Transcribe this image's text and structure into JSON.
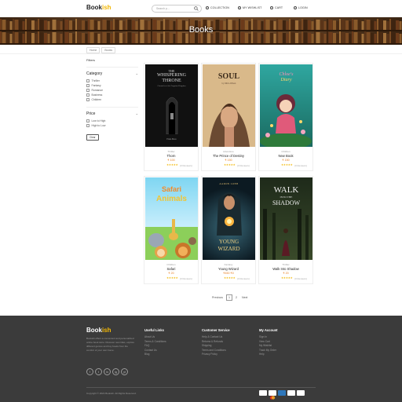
{
  "header": {
    "logo_main": "Book",
    "logo_accent": "ish",
    "search_placeholder": "Search p...",
    "nav": [
      {
        "label": "COLLECTION",
        "icon": "collection-icon"
      },
      {
        "label": "MY WISHLIST",
        "icon": "heart-icon"
      },
      {
        "label": "CART",
        "icon": "cart-icon"
      },
      {
        "label": "LOGIN",
        "icon": "user-icon"
      }
    ]
  },
  "banner": {
    "title": "Books"
  },
  "breadcrumb": [
    "Home",
    "Books"
  ],
  "sidebar": {
    "heading": "Filters",
    "category": {
      "title": "Category",
      "options": [
        "Thriller",
        "Fantasy",
        "Romance",
        "Business",
        "Children"
      ]
    },
    "price": {
      "title": "Price",
      "options": [
        "Low to High",
        "High to Low"
      ],
      "clear_label": "Clear"
    }
  },
  "products": [
    {
      "title": "Thorn",
      "category": "Thriller",
      "price": "₹ 100",
      "stars": "★★★★★",
      "reviews": "(0 Reviews)",
      "cover": "whispering"
    },
    {
      "title": "The Prince of Destiny",
      "category": "Adventure",
      "price": "₹ 150",
      "stars": "★★★★★",
      "reviews": "(0 Reviews)",
      "cover": "soul"
    },
    {
      "title": "New Book",
      "category": "Children",
      "price": "₹ 150",
      "stars": "★★★★★",
      "reviews": "(0 Reviews)",
      "cover": "chloe"
    },
    {
      "title": "Safari",
      "category": "Children",
      "price": "₹ 20",
      "stars": "★★★★★",
      "reviews": "(0 Reviews)",
      "cover": "safari"
    },
    {
      "title": "Young Wizard",
      "category": "Fantasy",
      "price": "₹450 ₹0",
      "stars": "★★★★★",
      "reviews": "(0 Reviews)",
      "cover": "wizard"
    },
    {
      "title": "Walk Into Shadow",
      "category": "Thriller",
      "price": "₹ 20",
      "stars": "★★★★★",
      "reviews": "(0 Reviews)",
      "cover": "walk"
    }
  ],
  "covers": {
    "whispering": {
      "line1": "THE",
      "line2": "WHISPERING",
      "line3": "THRONE",
      "sub": "Chronicles of the Forgotten Kingdom",
      "author": "Elena Moss"
    },
    "soul": {
      "line1": "SOUL",
      "sub": "by Olivia Wilson"
    },
    "chloe": {
      "line1": "Chloe's",
      "line2": "Diary"
    },
    "safari": {
      "line1": "Safari",
      "line2": "Animals"
    },
    "wizard": {
      "line0": "AARON LOEB",
      "line1": "YOUNG",
      "line2": "WIZARD"
    },
    "walk": {
      "line1": "WALK",
      "line2": "INTO THE",
      "line3": "SHADOW"
    }
  },
  "pagination": {
    "prev": "Previous",
    "pages": [
      "1",
      "2"
    ],
    "next": "Next"
  },
  "footer": {
    "logo_main": "Book",
    "logo_accent": "ish",
    "description": "Bookish offers a convenient and personalized online book store. Discover new titles, explore different genres and buy books from the comfort of your own home.",
    "socials": [
      "f",
      "t",
      "in",
      "ig",
      "yt"
    ],
    "columns": [
      {
        "title": "Useful Links",
        "links": [
          "About Us",
          "Terms & Conditions",
          "FAQ",
          "Contact Us",
          "Blog"
        ]
      },
      {
        "title": "Customer Service",
        "links": [
          "Help & Contact Us",
          "Returns & Refunds",
          "Shipping",
          "Terms and Conditions",
          "Privacy Policy"
        ]
      },
      {
        "title": "My Account",
        "links": [
          "Sign In",
          "View Cart",
          "My Wishlist",
          "Track My Order",
          "Help"
        ]
      }
    ],
    "copyright": "Copyright © 2024 Bookish. All Rights Reserved.",
    "payments": [
      "visa-icon",
      "mastercard-icon",
      "amex-icon",
      "paypal-icon",
      "discover-icon"
    ]
  },
  "colors": {
    "accent": "#f2b705",
    "price": "#e67e22",
    "footer_bg": "#3b3b3b"
  }
}
